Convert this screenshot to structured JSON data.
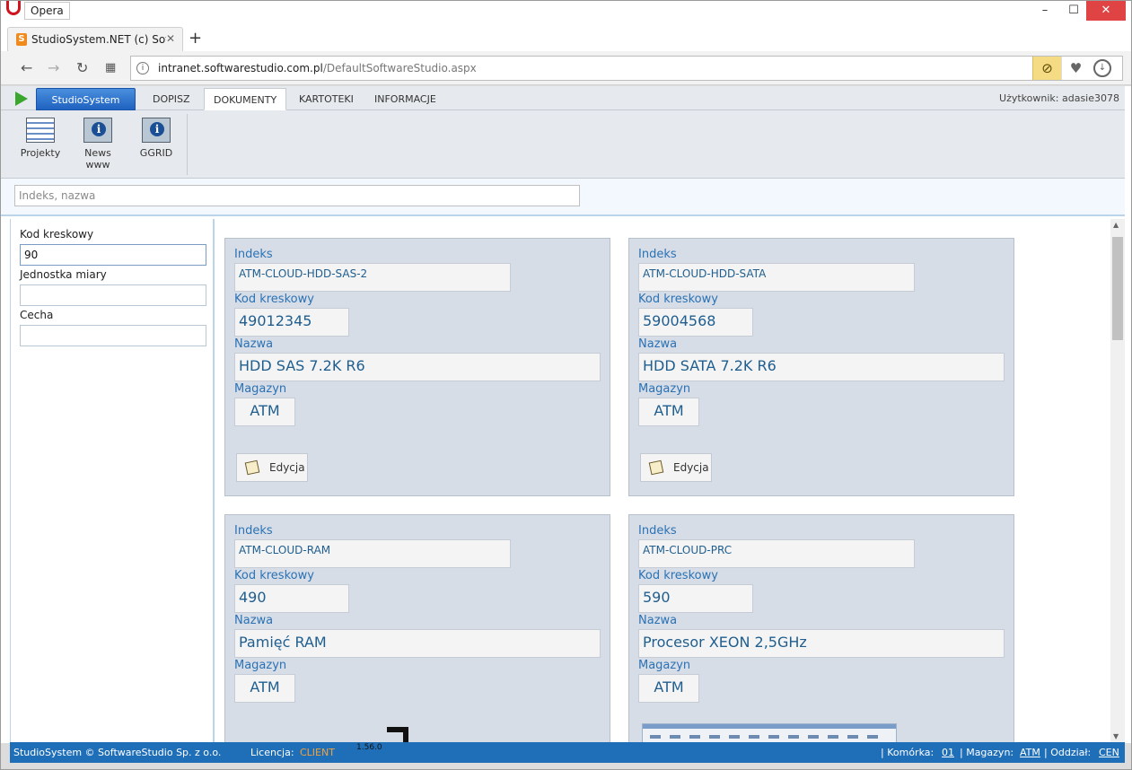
{
  "browser": {
    "app_name": "Opera",
    "tab_title": "StudioSystem.NET (c) SoftwareStudio",
    "tab_favicon": "S",
    "url_host": "intranet.softwarestudio.com.pl",
    "url_path": "/DefaultSoftwareStudio.aspx"
  },
  "menu": {
    "brand": "StudioSystem",
    "items": [
      "DOPISZ",
      "DOKUMENTY",
      "KARTOTEKI",
      "INFORMACJE"
    ],
    "active": "DOKUMENTY",
    "user_label": "Użytkownik: adasie3078"
  },
  "ribbon": {
    "buttons": [
      {
        "label": "Projekty",
        "icon": "calendar-icon"
      },
      {
        "label": "News www",
        "icon": "info-icon"
      },
      {
        "label": "GGRID",
        "icon": "info-icon"
      }
    ]
  },
  "search": {
    "placeholder": "Indeks, nazwa",
    "value": ""
  },
  "filters": {
    "barcode_label": "Kod kreskowy",
    "barcode_value": "90",
    "unit_label": "Jednostka miary",
    "unit_value": "",
    "feature_label": "Cecha",
    "feature_value": ""
  },
  "labels": {
    "index": "Indeks",
    "barcode": "Kod kreskowy",
    "name": "Nazwa",
    "warehouse": "Magazyn",
    "edit": "Edycja"
  },
  "products": [
    {
      "index": "ATM-CLOUD-HDD-SAS-2",
      "barcode": "49012345",
      "name": "HDD SAS 7.2K R6",
      "warehouse": "ATM"
    },
    {
      "index": "ATM-CLOUD-HDD-SATA",
      "barcode": "59004568",
      "name": "HDD SATA 7.2K R6",
      "warehouse": "ATM"
    },
    {
      "index": "ATM-CLOUD-RAM",
      "barcode": "490",
      "name": "Pamięć RAM",
      "warehouse": "ATM"
    },
    {
      "index": "ATM-CLOUD-PRC",
      "barcode": "590",
      "name": "Procesor XEON 2,5GHz",
      "warehouse": "ATM"
    }
  ],
  "footer": {
    "copyright": "StudioSystem © SoftwareStudio Sp. z o.o.",
    "license_label": "Licencja:",
    "license_value": "CLIENT",
    "version": "1.56.0",
    "cell_label": "Komórka:",
    "cell_value": "01",
    "warehouse_label": "Magazyn:",
    "warehouse_value": "ATM",
    "branch_label": "Oddział:",
    "branch_value": "CEN"
  }
}
